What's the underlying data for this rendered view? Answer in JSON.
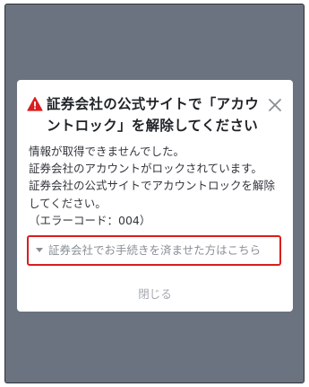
{
  "dialog": {
    "title": "証券会社の公式サイトで「アカウントロック」を解除してください",
    "icon": "warning-icon",
    "close_icon": "close-icon",
    "message_lines": [
      "情報が取得できませんでした。",
      "証券会社のアカウントがロックされています。",
      "証券会社の公式サイトでアカウントロックを解除",
      "してください。",
      "（エラーコード：004）"
    ],
    "detail_toggle_label": "証券会社でお手続きを済ませた方はこちら",
    "close_label": "閉じる"
  },
  "colors": {
    "overlay": "#6b7280",
    "warning": "#d81e1e",
    "highlight_border": "#d81e1e",
    "muted_text": "#8a8f96"
  }
}
